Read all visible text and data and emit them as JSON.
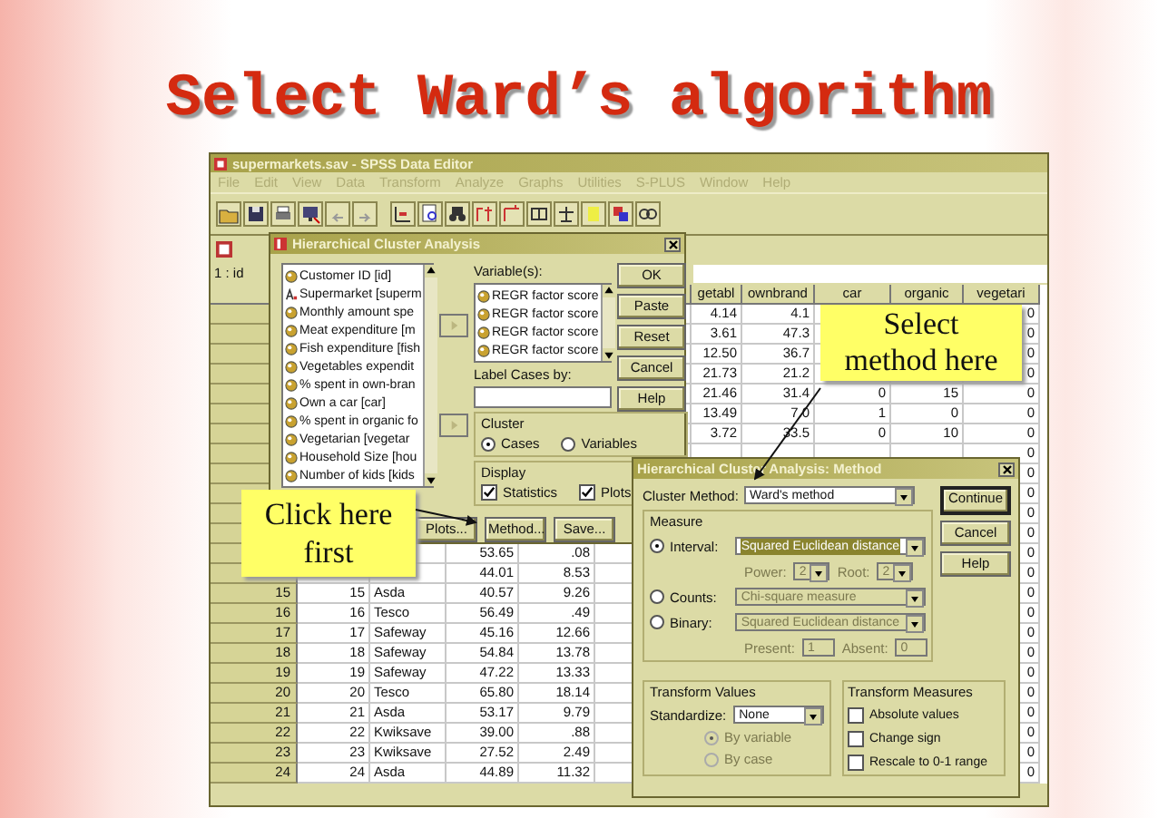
{
  "slide_title": "Select Ward’s algorithm",
  "data_editor": {
    "title": "supermarkets.sav - SPSS Data Editor",
    "menu": [
      {
        "label": "File",
        "disabled": true
      },
      {
        "label": "Edit",
        "disabled": true
      },
      {
        "label": "View",
        "disabled": true
      },
      {
        "label": "Data",
        "disabled": true
      },
      {
        "label": "Transform",
        "disabled": true
      },
      {
        "label": "Analyze",
        "disabled": true
      },
      {
        "label": "Graphs",
        "disabled": true
      },
      {
        "label": "Utilities",
        "disabled": true
      },
      {
        "label": "S-PLUS",
        "disabled": true
      },
      {
        "label": "Window",
        "disabled": true
      },
      {
        "label": "Help",
        "disabled": true
      }
    ],
    "cell_ref": "1 : id",
    "column_headers": [
      "getabl",
      "ownbrand",
      "car",
      "organic",
      "vegetari"
    ],
    "rows": [
      {
        "header": null,
        "cells": [
          null,
          null,
          null,
          null,
          null,
          null,
          "4.14",
          "4.1",
          null,
          null,
          "0"
        ]
      },
      {
        "header": null,
        "cells": [
          null,
          null,
          null,
          null,
          null,
          null,
          "3.61",
          "47.3",
          null,
          null,
          "0"
        ]
      },
      {
        "header": null,
        "cells": [
          null,
          null,
          null,
          null,
          null,
          null,
          "12.50",
          "36.7",
          null,
          null,
          "0"
        ]
      },
      {
        "header": null,
        "cells": [
          null,
          null,
          null,
          null,
          null,
          null,
          "21.73",
          "21.2",
          null,
          null,
          "0"
        ]
      },
      {
        "header": null,
        "cells": [
          null,
          null,
          null,
          null,
          null,
          null,
          "21.46",
          "31.4",
          "0",
          "15",
          "0"
        ]
      },
      {
        "header": null,
        "cells": [
          null,
          null,
          null,
          null,
          null,
          null,
          "13.49",
          "7.0",
          "1",
          "0",
          "0"
        ]
      },
      {
        "header": null,
        "cells": [
          null,
          null,
          null,
          null,
          null,
          null,
          "3.72",
          "33.5",
          "0",
          "10",
          "0"
        ]
      },
      {
        "header": null,
        "cells": [
          null,
          null,
          null,
          null,
          null,
          null,
          null,
          null,
          null,
          null,
          "0"
        ]
      },
      {
        "header": null,
        "cells": [
          null,
          null,
          null,
          null,
          null,
          null,
          null,
          null,
          null,
          null,
          "0"
        ]
      },
      {
        "header": null,
        "cells": [
          null,
          null,
          null,
          null,
          null,
          null,
          null,
          null,
          null,
          null,
          "0"
        ]
      },
      {
        "header": null,
        "cells": [
          null,
          null,
          null,
          null,
          null,
          null,
          null,
          null,
          null,
          null,
          "0"
        ]
      },
      {
        "header": null,
        "cells": [
          null,
          null,
          null,
          null,
          null,
          null,
          null,
          null,
          null,
          null,
          "0"
        ]
      },
      {
        "header": null,
        "cells": [
          null,
          null,
          "53.65",
          ".08",
          null,
          null,
          null,
          null,
          null,
          null,
          "0"
        ]
      },
      {
        "header": null,
        "cells": [
          null,
          null,
          "44.01",
          "8.53",
          null,
          null,
          null,
          null,
          null,
          null,
          "0"
        ]
      },
      {
        "header": "15",
        "cells": [
          "15",
          "Asda",
          "40.57",
          "9.26",
          null,
          null,
          null,
          null,
          null,
          null,
          "0"
        ]
      },
      {
        "header": "16",
        "cells": [
          "16",
          "Tesco",
          "56.49",
          ".49",
          null,
          null,
          null,
          null,
          null,
          null,
          "0"
        ]
      },
      {
        "header": "17",
        "cells": [
          "17",
          "Safeway",
          "45.16",
          "12.66",
          null,
          null,
          null,
          null,
          null,
          null,
          "0"
        ]
      },
      {
        "header": "18",
        "cells": [
          "18",
          "Safeway",
          "54.84",
          "13.78",
          null,
          null,
          null,
          null,
          null,
          null,
          "0"
        ]
      },
      {
        "header": "19",
        "cells": [
          "19",
          "Safeway",
          "47.22",
          "13.33",
          null,
          null,
          null,
          null,
          null,
          null,
          "0"
        ]
      },
      {
        "header": "20",
        "cells": [
          "20",
          "Tesco",
          "65.80",
          "18.14",
          null,
          null,
          null,
          null,
          null,
          null,
          "0"
        ]
      },
      {
        "header": "21",
        "cells": [
          "21",
          "Asda",
          "53.17",
          "9.79",
          null,
          null,
          null,
          null,
          null,
          null,
          "0"
        ]
      },
      {
        "header": "22",
        "cells": [
          "22",
          "Kwiksave",
          "39.00",
          ".88",
          null,
          null,
          null,
          null,
          null,
          null,
          "0"
        ]
      },
      {
        "header": "23",
        "cells": [
          "23",
          "Kwiksave",
          "27.52",
          "2.49",
          null,
          null,
          null,
          null,
          null,
          null,
          "0"
        ]
      },
      {
        "header": "24",
        "cells": [
          "24",
          "Asda",
          "44.89",
          "11.32",
          null,
          null,
          null,
          null,
          null,
          null,
          "0"
        ]
      }
    ]
  },
  "cluster_dialog": {
    "title": "Hierarchical Cluster Analysis",
    "variables": [
      {
        "label": "Customer ID [id]",
        "kind": "numeric"
      },
      {
        "label": "Supermarket [superm",
        "kind": "string"
      },
      {
        "label": "Monthly amount spe",
        "kind": "numeric"
      },
      {
        "label": "Meat expenditure [m",
        "kind": "numeric"
      },
      {
        "label": "Fish expenditure [fish",
        "kind": "numeric"
      },
      {
        "label": "Vegetables expendit",
        "kind": "numeric"
      },
      {
        "label": "% spent in own-bran",
        "kind": "numeric"
      },
      {
        "label": "Own a car [car]",
        "kind": "numeric"
      },
      {
        "label": "% spent in organic fo",
        "kind": "numeric"
      },
      {
        "label": "Vegetarian [vegetar",
        "kind": "numeric"
      },
      {
        "label": "Household Size [hou",
        "kind": "numeric"
      },
      {
        "label": "Number of kids [kids",
        "kind": "numeric"
      }
    ],
    "selected_label": "Variable(s):",
    "selected_variables": [
      "REGR factor score",
      "REGR factor score",
      "REGR factor score",
      "REGR factor score"
    ],
    "label_cases_label": "Label Cases by:",
    "cluster": {
      "title": "Cluster",
      "options": [
        {
          "label": "Cases",
          "selected": true
        },
        {
          "label": "Variables",
          "selected": false
        }
      ]
    },
    "display": {
      "title": "Display",
      "options": [
        {
          "label": "Statistics",
          "checked": true
        },
        {
          "label": "Plots",
          "checked": true
        }
      ]
    },
    "side_buttons": [
      "OK",
      "Paste",
      "Reset",
      "Cancel",
      "Help"
    ],
    "bottom_buttons": [
      "Plots...",
      "Method...",
      "Save..."
    ]
  },
  "method_dialog": {
    "title": "Hierarchical Cluster Analysis: Method",
    "cluster_method_label": "Cluster Method:",
    "cluster_method": "Ward's method",
    "buttons": [
      {
        "label": "Continue",
        "default": true
      },
      {
        "label": "Cancel",
        "default": false
      },
      {
        "label": "Help",
        "default": false
      }
    ],
    "measure": {
      "title": "Measure",
      "options": [
        {
          "label": "Interval:",
          "selected": true,
          "value": "Squared Euclidean distance",
          "disabled": false
        },
        {
          "label": "Counts:",
          "selected": false,
          "value": "Chi-square measure",
          "disabled": true
        },
        {
          "label": "Binary:",
          "selected": false,
          "value": "Squared Euclidean distance",
          "disabled": true
        }
      ],
      "power": {
        "label": "Power:",
        "value": "2",
        "disabled": true
      },
      "root": {
        "label": "Root:",
        "value": "2",
        "disabled": true
      },
      "present": {
        "label": "Present:",
        "value": "1",
        "disabled": true
      },
      "absent": {
        "label": "Absent:",
        "value": "0",
        "disabled": true
      }
    },
    "transform_values": {
      "title": "Transform Values",
      "standardize_label": "Standardize:",
      "standardize": "None",
      "options": [
        {
          "label": "By variable",
          "selected": true,
          "disabled": true
        },
        {
          "label": "By case",
          "selected": false,
          "disabled": true
        }
      ]
    },
    "transform_measures": {
      "title": "Transform Measures",
      "options": [
        {
          "label": "Absolute values",
          "checked": false
        },
        {
          "label": "Change sign",
          "checked": false
        },
        {
          "label": "Rescale to 0-1 range",
          "checked": false
        }
      ]
    }
  },
  "callouts": [
    {
      "text": "Select method here"
    },
    {
      "text": "Click here first"
    }
  ]
}
